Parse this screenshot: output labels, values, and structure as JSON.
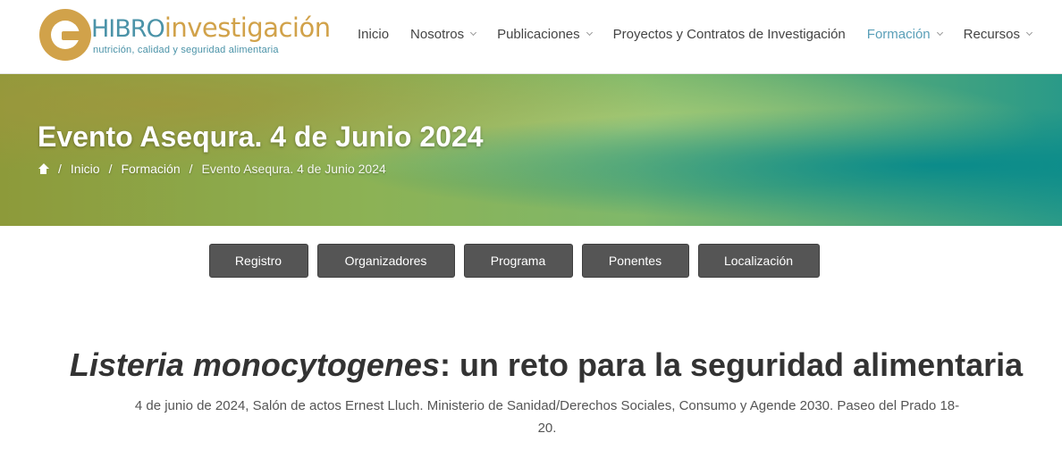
{
  "logo": {
    "title_a": "HIBRO",
    "title_b": "investigación",
    "tagline": "nutrición, calidad y seguridad alimentaria"
  },
  "nav": {
    "items": [
      {
        "label": "Inicio",
        "has_dropdown": false,
        "active": false
      },
      {
        "label": "Nosotros",
        "has_dropdown": true,
        "active": false
      },
      {
        "label": "Publicaciones",
        "has_dropdown": true,
        "active": false
      },
      {
        "label": "Proyectos y Contratos de Investigación",
        "has_dropdown": false,
        "active": false
      },
      {
        "label": "Formación",
        "has_dropdown": true,
        "active": true
      },
      {
        "label": "Recursos",
        "has_dropdown": true,
        "active": false
      }
    ]
  },
  "banner": {
    "title": "Evento Asequra. 4 de Junio 2024",
    "breadcrumb": {
      "home_icon": "home-icon",
      "items": [
        "Inicio",
        "Formación"
      ],
      "current": "Evento Asequra. 4 de Junio 2024"
    }
  },
  "buttons": [
    "Registro",
    "Organizadores",
    "Programa",
    "Ponentes",
    "Localización"
  ],
  "content": {
    "headline_italic": "Listeria monocytogenes",
    "headline_rest": ": un reto para la seguridad alimentaria",
    "subline": "4 de junio de 2024, Salón de actos Ernest Lluch. Ministerio de Sanidad/Derechos Sociales, Consumo y Agende 2030. Paseo del Prado 18-20."
  },
  "colors": {
    "brand_blue": "#4b93a8",
    "brand_gold": "#d1a24a",
    "nav_active": "#5a9fb8",
    "button_bg": "#555555"
  }
}
